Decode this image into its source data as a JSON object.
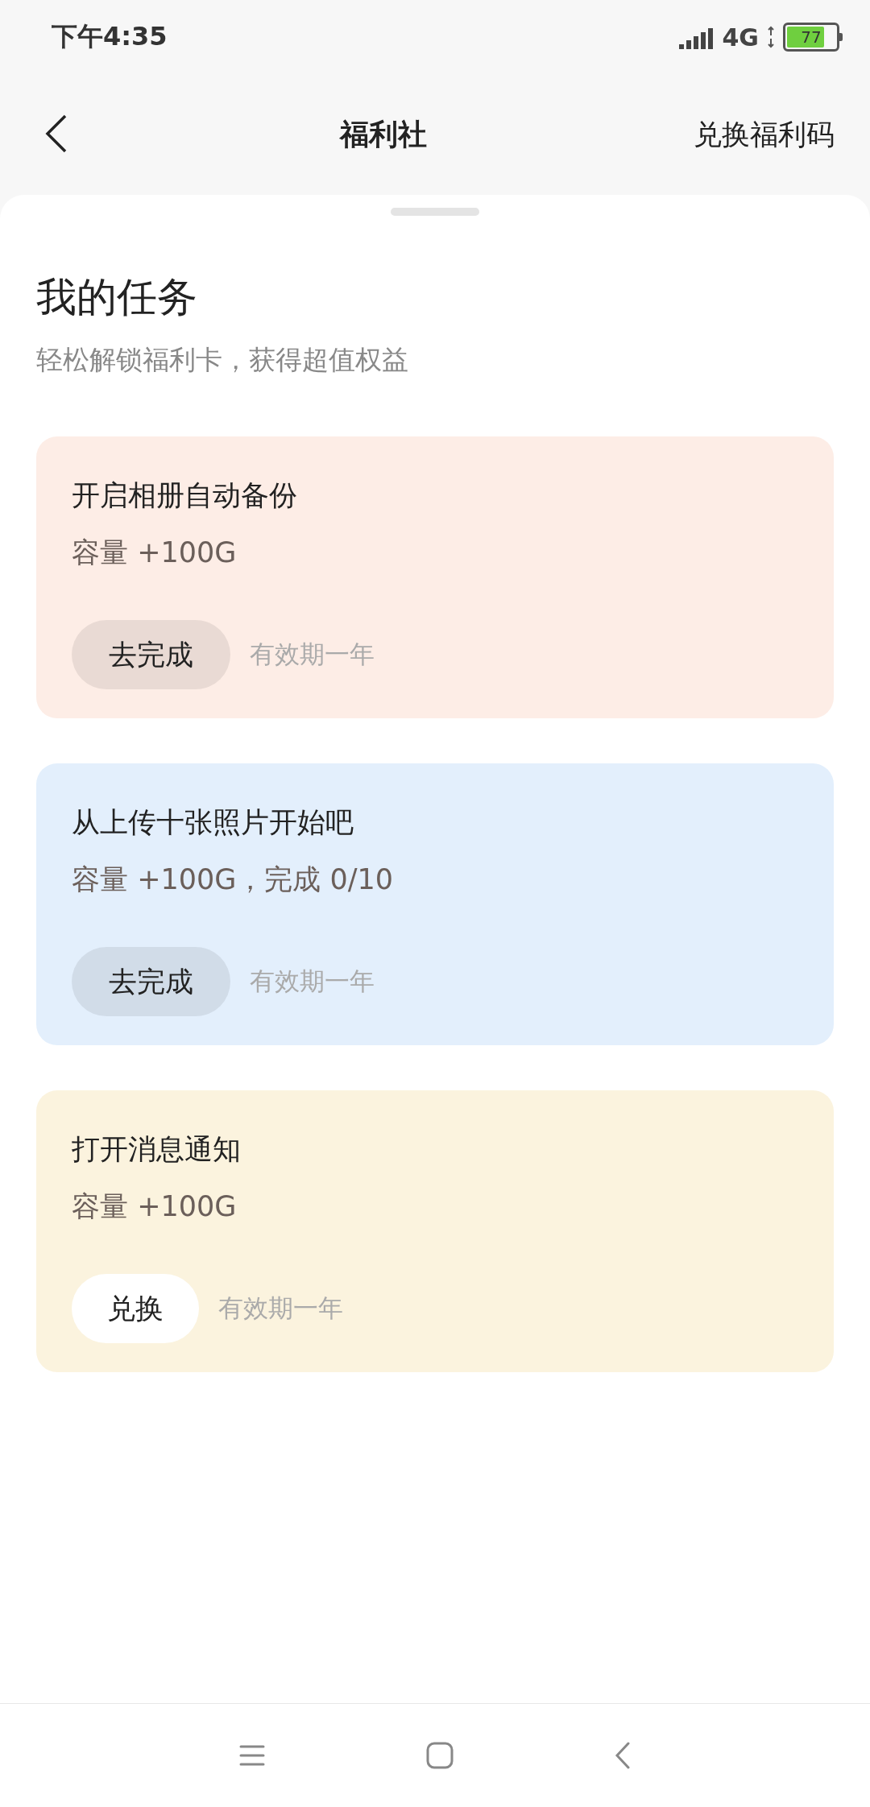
{
  "status_bar": {
    "time": "下午4:35",
    "network": "4G",
    "battery": "77"
  },
  "header": {
    "title": "福利社",
    "action": "兑换福利码"
  },
  "section": {
    "title": "我的任务",
    "subtitle": "轻松解锁福利卡，获得超值权益"
  },
  "tasks": [
    {
      "title": "开启相册自动备份",
      "reward": "容量 +100G",
      "button": "去完成",
      "kind": "go",
      "validity": "有效期一年",
      "color": "#fdede6"
    },
    {
      "title": "从上传十张照片开始吧",
      "reward": "容量 +100G，完成 0/10",
      "button": "去完成",
      "kind": "go",
      "validity": "有效期一年",
      "color": "#e3effc"
    },
    {
      "title": "打开消息通知",
      "reward": "容量 +100G",
      "button": "兑换",
      "kind": "redeem",
      "validity": "有效期一年",
      "color": "#fbf3de"
    }
  ]
}
